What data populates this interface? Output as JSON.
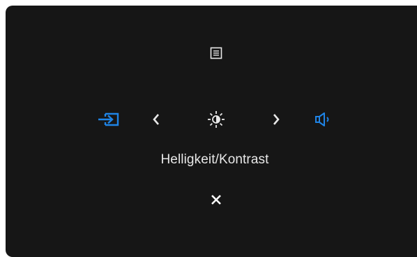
{
  "osd": {
    "current_function_label": "Helligkeit/Kontrast",
    "accent_color": "#1f84e6",
    "icons": {
      "menu": "menu-list-icon",
      "input": "input-source-icon",
      "prev": "chevron-left-icon",
      "brightness": "brightness-contrast-icon",
      "next": "chevron-right-icon",
      "volume": "volume-icon",
      "close": "close-icon"
    }
  }
}
